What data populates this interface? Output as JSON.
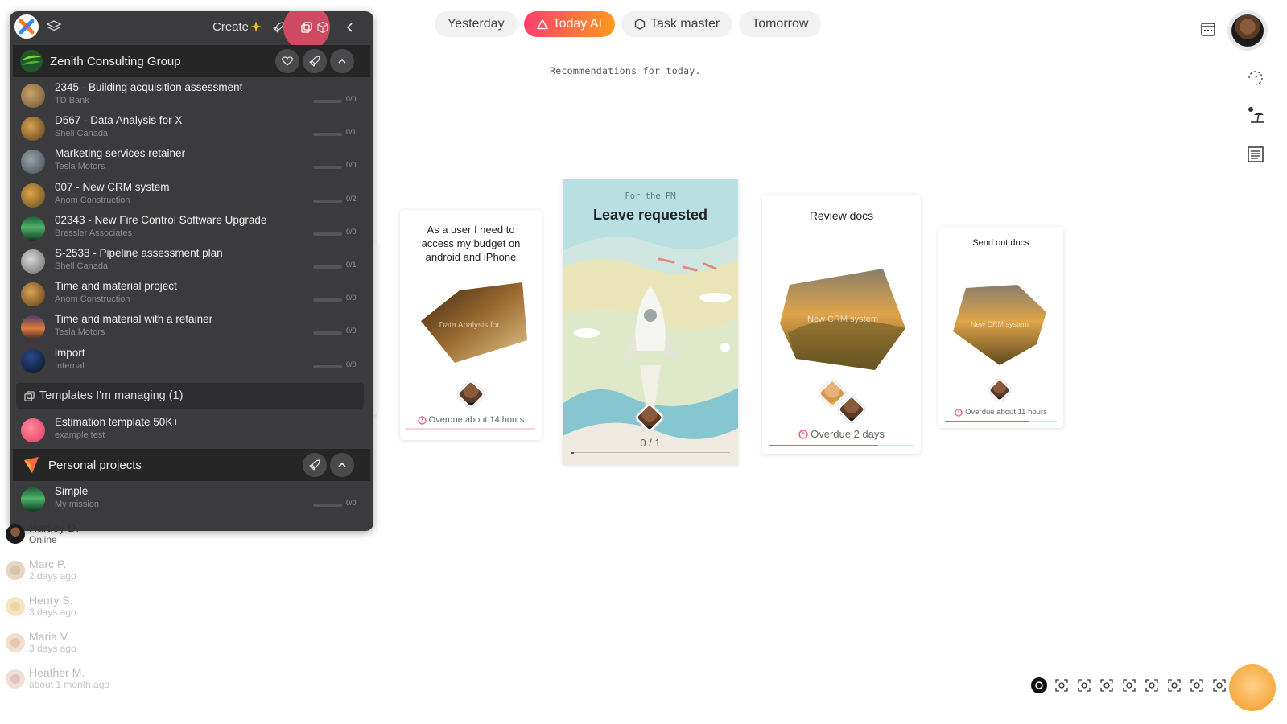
{
  "tabs": [
    {
      "label": "Yesterday"
    },
    {
      "label": "Today AI",
      "active": true
    },
    {
      "label": "Task master"
    },
    {
      "label": "Tomorrow"
    }
  ],
  "recommendation": "Recommendations for today.",
  "panel": {
    "create_label": "Create",
    "group1": {
      "name": "Zenith Consulting Group",
      "projects": [
        {
          "title": "2345 - Building acquisition assessment",
          "client": "TD Bank",
          "count": "0/0",
          "progress": 0
        },
        {
          "title": "D567 - Data Analysis for X",
          "client": "Shell Canada",
          "count": "0/1",
          "progress": 0
        },
        {
          "title": "Marketing services retainer",
          "client": "Tesla Motors",
          "count": "0/0",
          "progress": 0
        },
        {
          "title": "007 - New CRM system",
          "client": "Anom Construction",
          "count": "0/2",
          "progress": 0
        },
        {
          "title": "02343 - New Fire Control Software Upgrade",
          "client": "Bressler Associates",
          "count": "0/0",
          "progress": 0
        },
        {
          "title": "S-2538 - Pipeline assessment plan",
          "client": "Shell Canada",
          "count": "0/1",
          "progress": 0
        },
        {
          "title": "Time and material project",
          "client": "Anom Construction",
          "count": "0/0",
          "progress": 0
        },
        {
          "title": "Time and material with a retainer",
          "client": "Tesla Motors",
          "count": "0/0",
          "progress": 0
        },
        {
          "title": "import",
          "client": "Internal",
          "count": "0/0",
          "progress": 0
        }
      ]
    },
    "templates": {
      "label": "Templates I'm managing (1)",
      "items": [
        {
          "title": "Estimation template 50K+",
          "client": "example test"
        }
      ]
    },
    "group2": {
      "name": "Personal projects",
      "projects": [
        {
          "title": "Simple",
          "client": "My mission",
          "count": "0/0",
          "progress": 0
        }
      ]
    }
  },
  "users": [
    {
      "name": "Hartley D.",
      "status": "Online"
    },
    {
      "name": "Marc P.",
      "status": "2 days ago"
    },
    {
      "name": "Henry S.",
      "status": "3 days ago"
    },
    {
      "name": "Maria V.",
      "status": "3 days ago"
    },
    {
      "name": "Heather M.",
      "status": "about 1 month ago"
    }
  ],
  "cards": {
    "budget": {
      "title": "As a user I need to access my budget on android and iPhone",
      "image_label": "Data Analysis for...",
      "overdue": "Overdue about 14 hours"
    },
    "leave": {
      "subtitle": "For the PM",
      "title": "Leave requested",
      "count": "0 / 1",
      "progress": 0
    },
    "review": {
      "title": "Review docs",
      "image_label": "New CRM system",
      "overdue": "Overdue 2 days",
      "progress": 0.75
    },
    "send": {
      "title": "Send out docs",
      "image_label": "New CRM system",
      "overdue": "Overdue about 11 hours",
      "progress": 0.75
    }
  },
  "colors": {
    "accent_start": "#ff3d6e",
    "accent_end": "#ff9a1f",
    "panel_bg": "#3b3b3d",
    "overdue": "#f1557a"
  }
}
